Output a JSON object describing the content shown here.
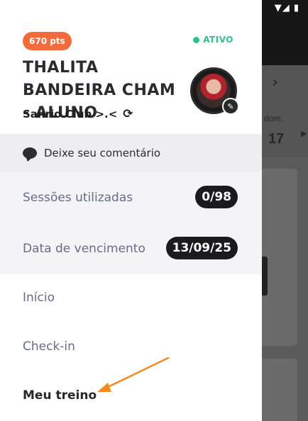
{
  "background": {
    "status_icons": "▼◢ ▮",
    "nav_chevron": "›",
    "day_label": "dom.",
    "day_number": "17",
    "day_chevron": "▶"
  },
  "profile": {
    "points_badge": "670 pts",
    "status": "ATIVO",
    "name": "THALITA BANDEIRA CHAM - ALUNO",
    "club": "Sanrio Club >.<",
    "club_switch_icon": "⟳",
    "edit_icon": "✎"
  },
  "comment": {
    "label": "Deixe seu comentário"
  },
  "info": {
    "sessions_label": "Sessões utilizadas",
    "sessions_value": "0/98",
    "expiry_label": "Data de vencimento",
    "expiry_value": "13/09/25"
  },
  "menu": {
    "items": [
      {
        "label": "Início"
      },
      {
        "label": "Check-in"
      },
      {
        "label": "Meu treino"
      }
    ]
  },
  "colors": {
    "points_badge": "#f26b3a",
    "status_active": "#2fbf8f",
    "annotation_arrow": "#f58a1f"
  }
}
